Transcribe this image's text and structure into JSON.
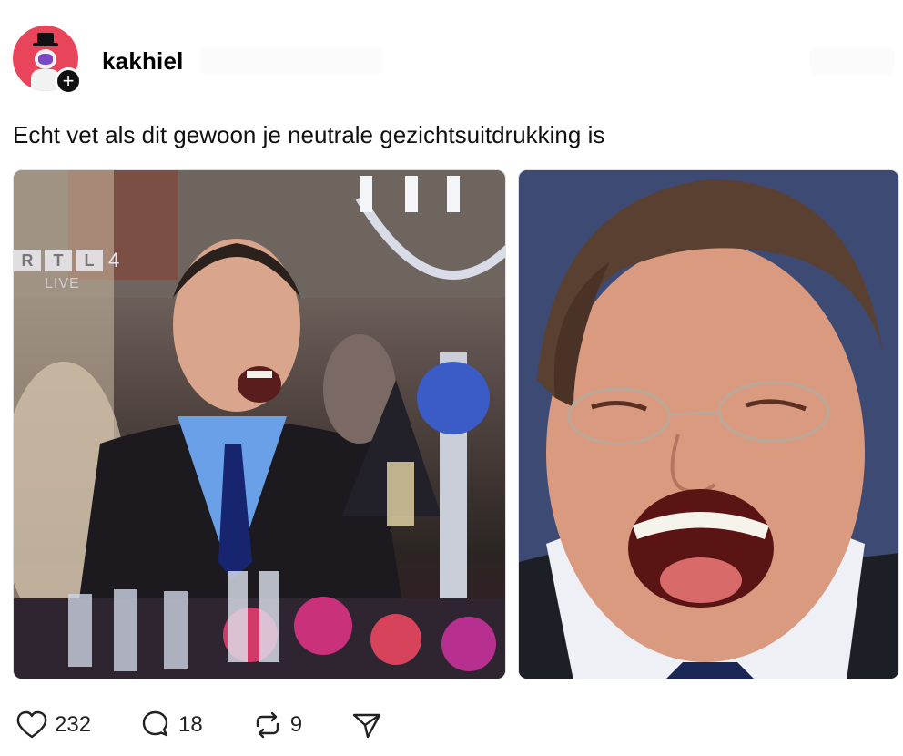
{
  "post": {
    "username": "kakhiel",
    "follow_symbol": "+",
    "caption": "Echt vet als dit gewoon je neutrale gezichtsuitdrukking is",
    "images": [
      {
        "overlay": {
          "channel_letters": [
            "R",
            "T",
            "L"
          ],
          "channel_number": "4",
          "live_label": "LIVE"
        }
      },
      {}
    ]
  },
  "actions": {
    "likes": "232",
    "replies": "18",
    "reposts": "9"
  },
  "icons": {
    "avatar": "astronaut-avatar",
    "follow": "plus-icon",
    "like": "heart-icon",
    "reply": "comment-icon",
    "repost": "repost-icon",
    "share": "send-icon"
  },
  "colors": {
    "text": "#000000",
    "avatar_bg": "#e8455a",
    "background": "#ffffff"
  }
}
